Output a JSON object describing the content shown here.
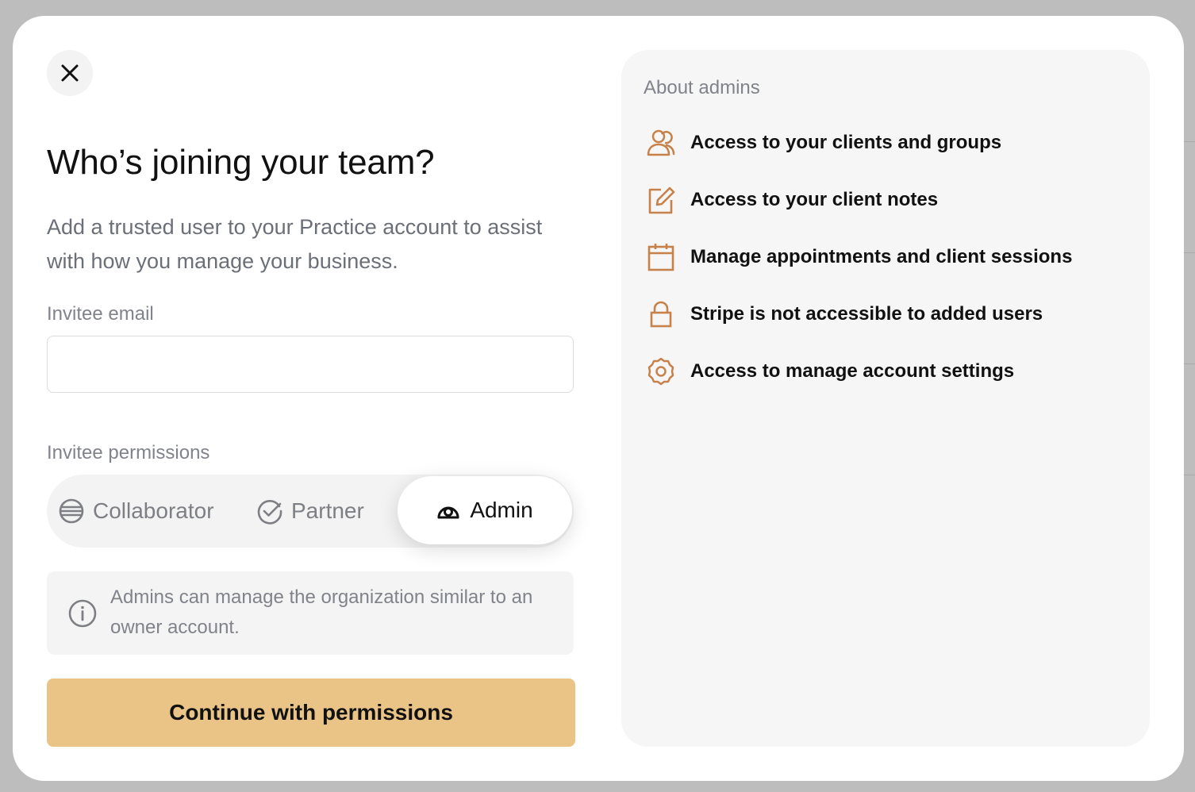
{
  "dialog": {
    "title": "Who’s joining your team?",
    "subtitle": "Add a trusted user to your Practice account to assist with how you manage your business.",
    "email_label": "Invitee email",
    "email_value": "",
    "email_placeholder": "",
    "permissions_label": "Invitee permissions",
    "permissions": [
      {
        "label": "Collaborator",
        "icon": "stack-circle-icon",
        "selected": false
      },
      {
        "label": "Partner",
        "icon": "check-circle-icon",
        "selected": false
      },
      {
        "label": "Admin",
        "icon": "admin-badge-icon",
        "selected": true
      }
    ],
    "info_text": "Admins can manage the organization similar to an owner account.",
    "continue_label": "Continue with permissions"
  },
  "side_panel": {
    "title": "About admins",
    "features": [
      {
        "text": "Access to your clients and groups",
        "icon": "users-icon"
      },
      {
        "text": "Access to your client notes",
        "icon": "edit-note-icon"
      },
      {
        "text": "Manage appointments and client sessions",
        "icon": "calendar-icon"
      },
      {
        "text": "Stripe is not accessible to added users",
        "icon": "lock-icon"
      },
      {
        "text": "Access to manage account settings",
        "icon": "gear-icon"
      }
    ]
  },
  "colors": {
    "accent": "#eac487",
    "icon_accent": "#c6824a",
    "backdrop": "#bdbdbd"
  }
}
